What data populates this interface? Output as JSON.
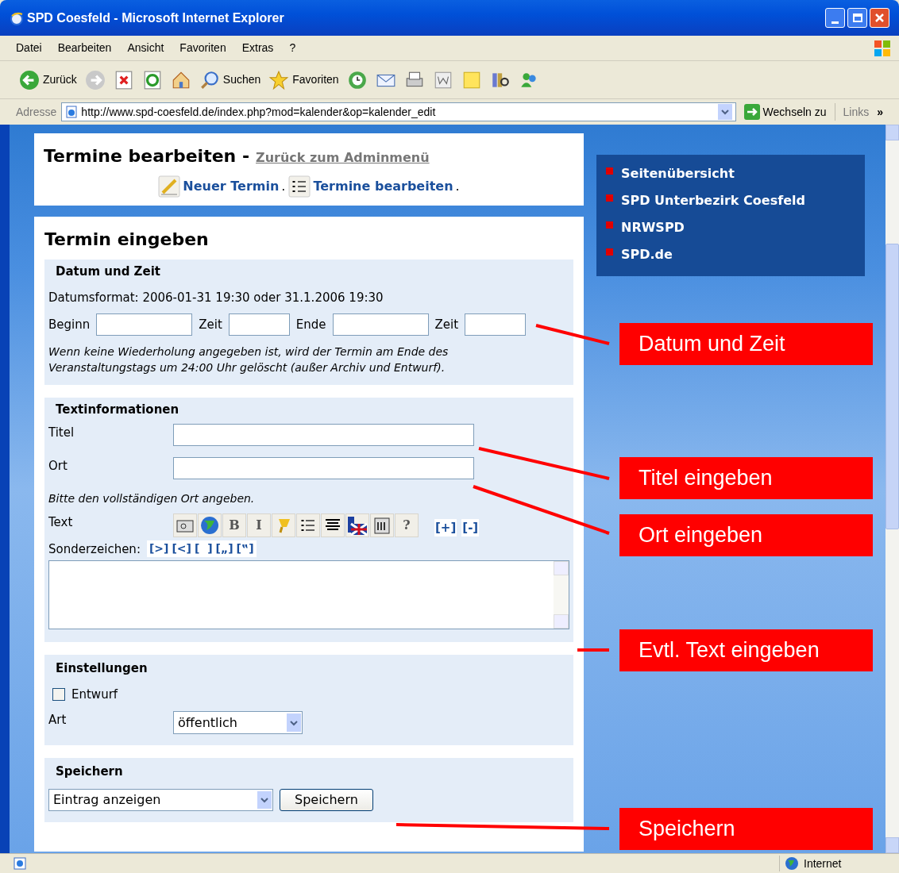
{
  "window": {
    "title": "SPD Coesfeld - Microsoft Internet Explorer"
  },
  "menu": [
    "Datei",
    "Bearbeiten",
    "Ansicht",
    "Favoriten",
    "Extras",
    "?"
  ],
  "toolbar": [
    {
      "kind": "back",
      "label": "Zurück"
    },
    {
      "kind": "forward"
    },
    {
      "kind": "stop"
    },
    {
      "kind": "refresh"
    },
    {
      "kind": "home"
    },
    {
      "kind": "search",
      "label": "Suchen"
    },
    {
      "kind": "favorites",
      "label": "Favoriten"
    },
    {
      "kind": "history"
    },
    {
      "kind": "mail"
    },
    {
      "kind": "print"
    },
    {
      "kind": "word"
    },
    {
      "kind": "note"
    },
    {
      "kind": "research"
    },
    {
      "kind": "messenger"
    }
  ],
  "address": {
    "label": "Adresse",
    "url": "http://www.spd-coesfeld.de/index.php?mod=kalender&op=kalender_edit",
    "go": "Wechseln zu",
    "links": "Links",
    "more": "»"
  },
  "header": {
    "title": "Termine bearbeiten -",
    "back_link": "Zurück zum Adminmenü",
    "actions": [
      {
        "kind": "new",
        "label": "Neuer Termin",
        "sep": "."
      },
      {
        "kind": "list",
        "label": "Termine bearbeiten",
        "sep": "."
      }
    ]
  },
  "form": {
    "title": "Termin eingeben",
    "datetime": {
      "heading": "Datum und Zeit",
      "format_hint": "Datumsformat: 2006-01-31 19:30 oder 31.1.2006 19:30",
      "fields": [
        {
          "label": "Beginn",
          "kind": "date"
        },
        {
          "label": "Zeit",
          "kind": "time"
        },
        {
          "label": "Ende",
          "kind": "date"
        },
        {
          "label": "Zeit",
          "kind": "time"
        }
      ],
      "note": "Wenn keine Wiederholung angegeben ist, wird der Termin am Ende des Veranstaltungstags um 24:00 Uhr gelöscht (außer Archiv und Entwurf)."
    },
    "text": {
      "heading": "Textinformationen",
      "title_label": "Titel",
      "place_label": "Ort",
      "place_hint": "Bitte den vollständigen Ort angeben.",
      "text_label": "Text",
      "tools": [
        {
          "kind": "image"
        },
        {
          "kind": "globe"
        },
        {
          "kind": "glyph",
          "label": "B"
        },
        {
          "kind": "glyph",
          "label": "I"
        },
        {
          "kind": "highlight"
        },
        {
          "kind": "list"
        },
        {
          "kind": "align"
        },
        {
          "kind": "flag"
        },
        {
          "kind": "code"
        },
        {
          "kind": "glyph",
          "label": "?"
        }
      ],
      "size_links": [
        "[+]",
        "[-]"
      ],
      "special_label": "Sonderzeichen:",
      "special_chars": [
        "[>]",
        "[<]",
        "[  ]",
        "[„]",
        "[‟]"
      ]
    },
    "settings": {
      "heading": "Einstellungen",
      "draft": {
        "label": "Entwurf",
        "checked": false
      },
      "type_label": "Art",
      "type_value": "öffentlich"
    },
    "save": {
      "heading": "Speichern",
      "mode": "Eintrag anzeigen",
      "button": "Speichern"
    }
  },
  "sidebar": [
    "Seitenübersicht",
    "SPD Unterbezirk Coesfeld",
    "NRWSPD",
    "SPD.de"
  ],
  "callouts": [
    "Datum und Zeit",
    "Titel eingeben",
    "Ort eingeben",
    "Evtl. Text eingeben",
    "Speichern"
  ],
  "status_bar": {
    "zone": "Internet"
  }
}
